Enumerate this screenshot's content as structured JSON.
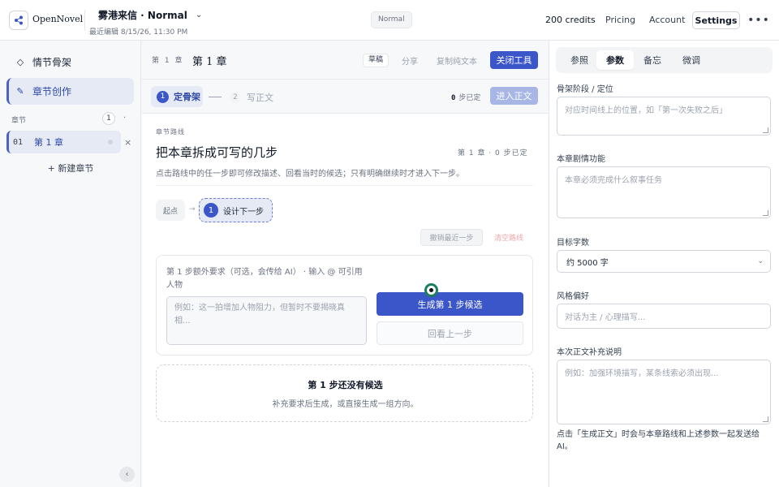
{
  "app": {
    "name": "OpenNovel"
  },
  "header": {
    "doc_title": "雾港来信 · Normal",
    "last_edited": "最近编辑 8/15/26, 11:30 PM",
    "mode": "Normal",
    "credits": "200 credits",
    "pricing": "Pricing",
    "account": "Account",
    "settings": "Settings",
    "more": "•••"
  },
  "sidebar": {
    "items": [
      {
        "label": "情节骨架",
        "icon": "◇"
      },
      {
        "label": "章节创作",
        "icon": "✎"
      }
    ],
    "chapters_label": "章节",
    "chapters_count": "1",
    "chapters_more": "·",
    "chapters": [
      {
        "num": "01",
        "title": "第 1 章"
      }
    ],
    "close": "×",
    "new_chapter": "+ 新建章节",
    "collapse": "‹"
  },
  "editor": {
    "chapter_small": "第 1 章",
    "chapter_title": "第 1 章",
    "draft": "草稿",
    "share": "分享",
    "copy_text": "复制纯文本",
    "close_tools": "关闭工具",
    "steps": {
      "step1_num": "1",
      "step1_label": "定骨架",
      "step2_num": "2",
      "step2_label": "写正文",
      "done_count": "0",
      "done_label": "步已定",
      "enter_text": "进入正文"
    },
    "route": {
      "label": "章节路线",
      "title": "把本章拆成可写的几步",
      "meta": "第 1 章 · 0 步已定",
      "desc": "点击路线中的任一步即可修改描述、回看当时的候选；只有明确继续时才进入下一步。",
      "start": "起点",
      "arrow": "→",
      "node_num": "1",
      "node_label": "设计下一步",
      "undo": "撤销最近一步",
      "clear": "清空路线"
    },
    "request": {
      "label": "第 1 步额外要求（可选，会传给 AI） · 输入 @ 可引用人物",
      "placeholder": "例如：这一拍增加人物阻力，但暂时不要揭晓真相...",
      "generate": "生成第 1 步候选",
      "back": "回看上一步"
    },
    "empty": {
      "title": "第 1 步还没有候选",
      "desc": "补充要求后生成，或直接生成一组方向。"
    }
  },
  "panel": {
    "tabs": [
      "参照",
      "参数",
      "备忘",
      "微调"
    ],
    "active_tab": "参数",
    "fields": {
      "stage_label": "骨架阶段 / 定位",
      "stage_placeholder": "对应时间线上的位置，如「第一次失败之后」",
      "function_label": "本章剧情功能",
      "function_placeholder": "本章必须完成什么叙事任务",
      "words_label": "目标字数",
      "words_value": "约 5000 字",
      "style_label": "风格偏好",
      "style_placeholder": "对话为主 / 心理描写...",
      "notes_label": "本次正文补充说明",
      "notes_placeholder": "例如：加强环境描写，某条线索必须出现..."
    },
    "footnote": "点击「生成正文」时会与本章路线和上述参数一起发送给 AI。"
  }
}
